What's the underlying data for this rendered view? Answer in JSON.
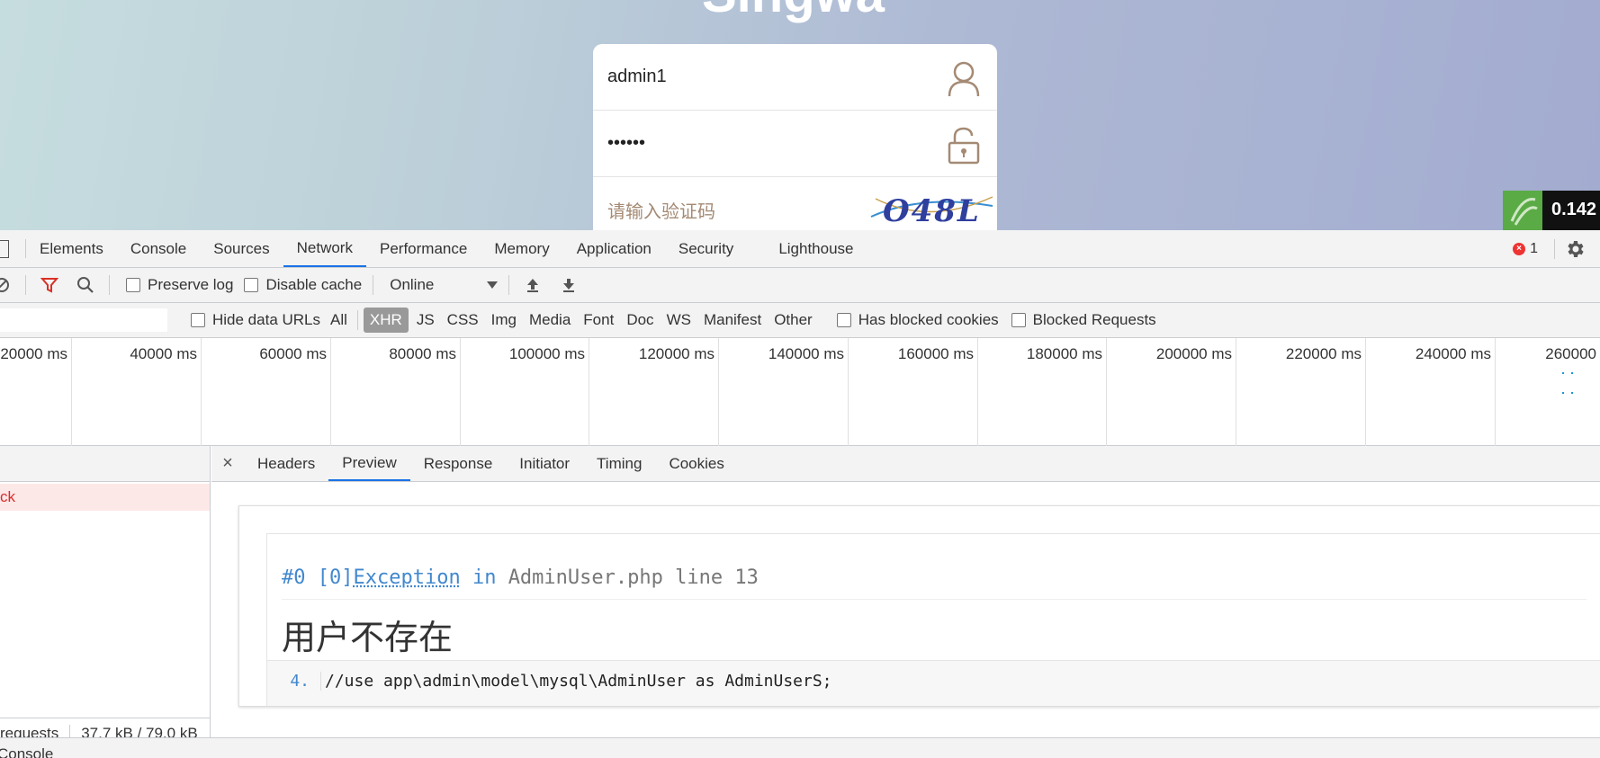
{
  "page": {
    "title": "Singwa",
    "username": "admin1",
    "password_masked": "••••••",
    "captcha_placeholder": "请输入验证码",
    "captcha_text": "O48L",
    "fps_value": "0.142"
  },
  "devtools": {
    "tabs": [
      "Elements",
      "Console",
      "Sources",
      "Network",
      "Performance",
      "Memory",
      "Application",
      "Security",
      "Lighthouse"
    ],
    "active_tab": "Network",
    "error_count": "1",
    "toolbar": {
      "preserve_log": "Preserve log",
      "disable_cache": "Disable cache",
      "throttling": "Online"
    },
    "filter": {
      "hide_data_urls": "Hide data URLs",
      "types": [
        "All",
        "XHR",
        "JS",
        "CSS",
        "Img",
        "Media",
        "Font",
        "Doc",
        "WS",
        "Manifest",
        "Other"
      ],
      "active_type": "XHR",
      "has_blocked_cookies": "Has blocked cookies",
      "blocked_requests": "Blocked Requests"
    },
    "timeline_ticks": [
      "20000 ms",
      "40000 ms",
      "60000 ms",
      "80000 ms",
      "100000 ms",
      "120000 ms",
      "140000 ms",
      "160000 ms",
      "180000 ms",
      "200000 ms",
      "220000 ms",
      "240000 ms",
      "260000"
    ],
    "request_name": "ck",
    "status": {
      "requests": "requests",
      "transferred": "37.7 kB / 79.0 kB"
    },
    "detail_tabs": [
      "Headers",
      "Preview",
      "Response",
      "Initiator",
      "Timing",
      "Cookies"
    ],
    "active_detail_tab": "Preview",
    "preview": {
      "exception_prefix": "#0 [0]",
      "exception_class": "Exception",
      "exception_in": " in ",
      "exception_file": "AdminUser.php line 13",
      "message": "用户不存在",
      "line_number": "4.",
      "code": "//use app\\admin\\model\\mysql\\AdminUser as AdminUserS;"
    },
    "drawer_label": "Console"
  },
  "colors": {
    "accent": "#1a73e8",
    "error": "#d92c2c",
    "exception_blue": "#4288ce",
    "login_icon": "#a48a74"
  }
}
